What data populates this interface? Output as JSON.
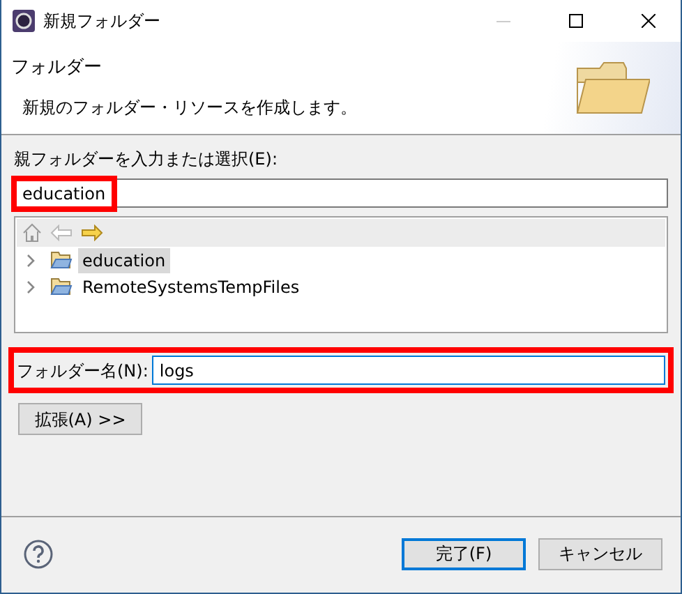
{
  "window": {
    "title": "新規フォルダー"
  },
  "header": {
    "title": "フォルダー",
    "description": "新規のフォルダー・リソースを作成します。"
  },
  "parent_field": {
    "label": "親フォルダーを入力または選択(E):",
    "value": "education",
    "highlighted": true
  },
  "tree": {
    "items": [
      {
        "label": "education",
        "selected": true,
        "expanded": false
      },
      {
        "label": "RemoteSystemsTempFiles",
        "selected": false,
        "expanded": false
      }
    ]
  },
  "folder_name": {
    "label": "フォルダー名(N):",
    "value": "logs",
    "highlighted": true,
    "focused": true
  },
  "advanced_button": "拡張(A) >>",
  "buttons": [
    {
      "label": "完了(F)",
      "default": true
    },
    {
      "label": "キャンセル",
      "default": false
    }
  ]
}
